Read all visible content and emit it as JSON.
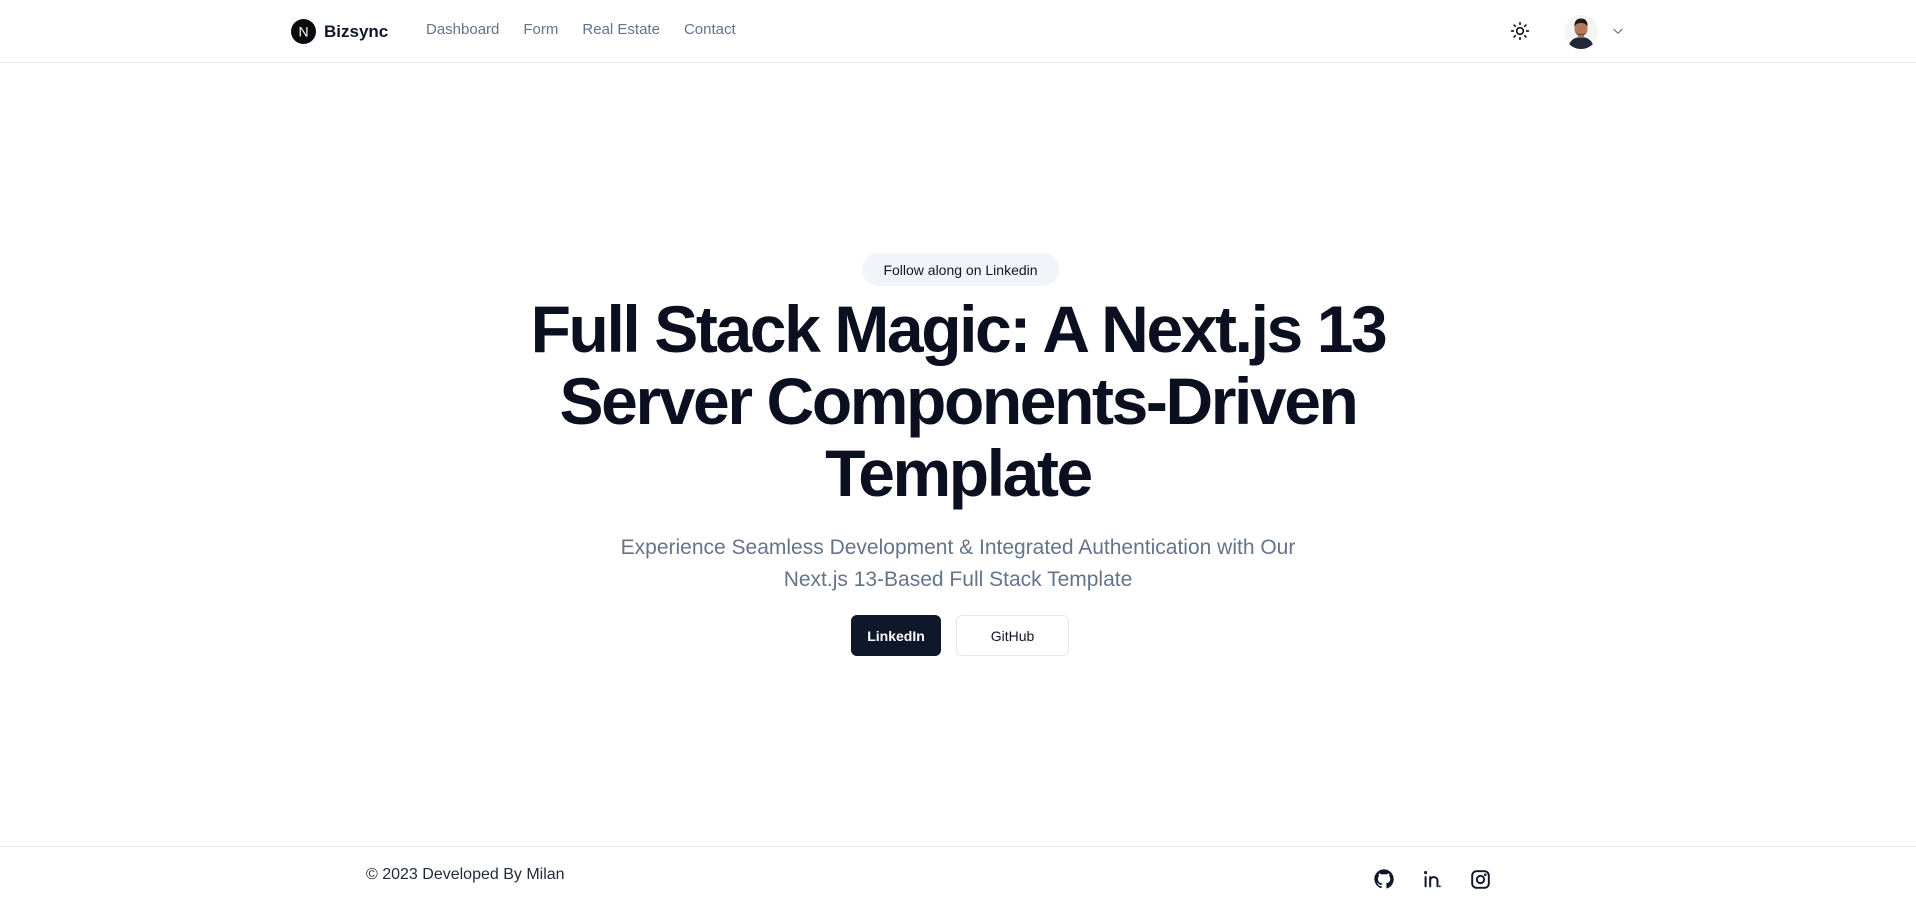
{
  "header": {
    "brand": {
      "logo_letter": "N",
      "name": "Bizsync"
    },
    "nav": [
      {
        "label": "Dashboard"
      },
      {
        "label": "Form"
      },
      {
        "label": "Real Estate"
      },
      {
        "label": "Contact"
      }
    ],
    "theme_toggle_icon": "sun-icon",
    "avatar_icon": "user-avatar",
    "menu_icon": "chevron-down-icon"
  },
  "hero": {
    "pill": "Follow along on Linkedin",
    "headline": "Full Stack Magic: A Next.js 13 Server Components-Driven Template",
    "subheadline": "Experience Seamless Development & Integrated Authentication with Our Next.js 13-Based Full Stack Template",
    "primary_button": "LinkedIn",
    "secondary_button": "GitHub"
  },
  "footer": {
    "copyright": "© 2023 Developed By Milan",
    "social": [
      "github-icon",
      "linkedin-icon",
      "instagram-icon"
    ]
  },
  "colors": {
    "primary": "#0f172a",
    "muted_text": "#64748b",
    "pill_bg": "#f1f5f9",
    "border": "#e5e7eb"
  }
}
